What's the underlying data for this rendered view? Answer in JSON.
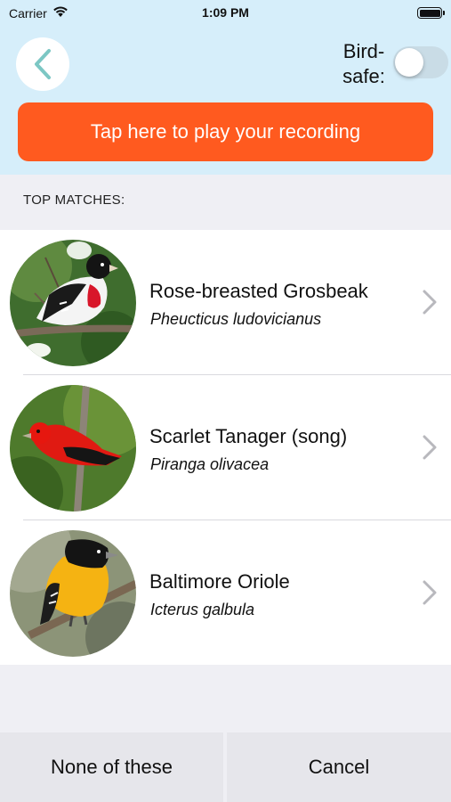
{
  "status_bar": {
    "carrier": "Carrier",
    "time": "1:09 PM",
    "wifi_icon": "wifi-icon",
    "battery_icon": "battery-full-icon"
  },
  "header": {
    "back_icon": "chevron-left-icon",
    "bird_safe_label": "Bird-\nsafe:",
    "bird_safe_label_line1": "Bird-",
    "bird_safe_label_line2": "safe:",
    "bird_safe_on": false,
    "play_button_label": "Tap here to play your recording"
  },
  "section": {
    "title": "TOP MATCHES:"
  },
  "matches": [
    {
      "common_name": "Rose-breasted Grosbeak",
      "scientific_name": "Pheucticus ludovicianus"
    },
    {
      "common_name": "Scarlet Tanager (song)",
      "scientific_name": "Piranga olivacea"
    },
    {
      "common_name": "Baltimore Oriole",
      "scientific_name": "Icterus galbula"
    }
  ],
  "footer": {
    "none_label": "None of these",
    "cancel_label": "Cancel"
  },
  "colors": {
    "header_bg": "#d6eefa",
    "accent_orange": "#ff5a1f",
    "back_chevron": "#7cc7c4",
    "page_bg": "#efeff4"
  }
}
